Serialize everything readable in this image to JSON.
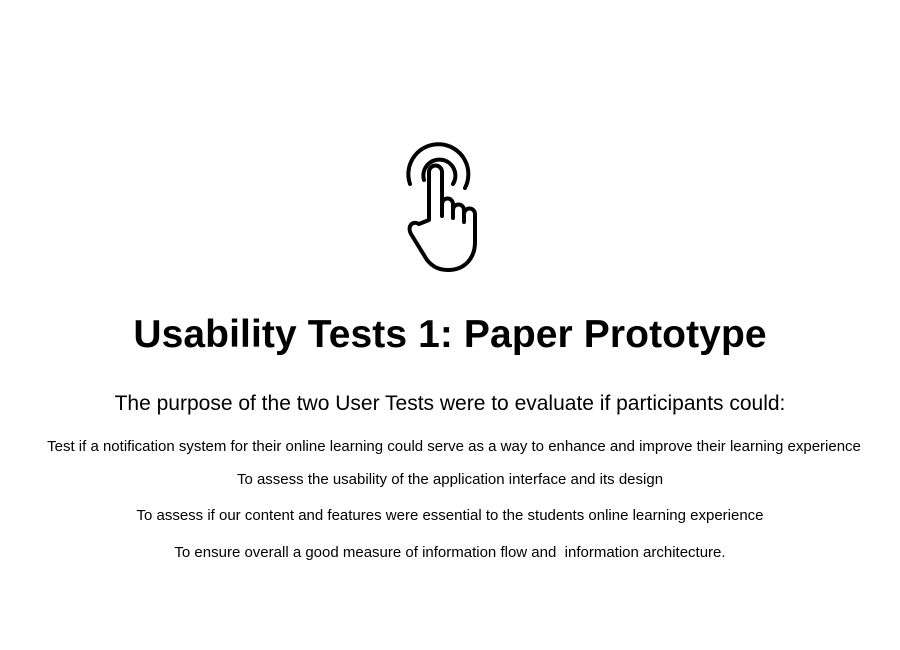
{
  "hero": {
    "icon": "tap-gesture-icon"
  },
  "title": "Usability Tests 1: Paper Prototype",
  "subtitle": "The purpose of the two User Tests were to evaluate if participants could:",
  "goals": [
    "Test if a notification system for their online learning could serve as a way to enhance and improve their learning experience",
    "To assess the usability of the application interface and its design",
    "To assess if our content and features were essential to the students online learning experience",
    "To ensure overall a good measure of information flow and  information architecture."
  ]
}
